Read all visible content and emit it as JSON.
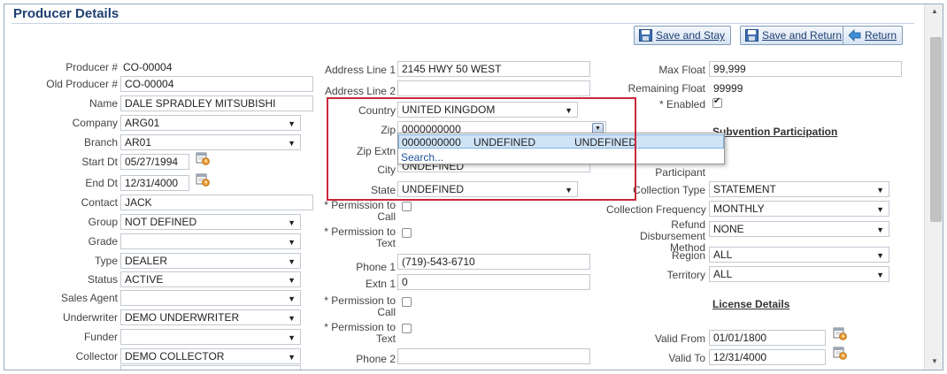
{
  "page_title": "Producer Details",
  "toolbar": {
    "save_stay": "Save and Stay",
    "save_return": "Save and Return",
    "return": "Return"
  },
  "left": {
    "producer_no_label": "Producer #",
    "producer_no": "CO-00004",
    "old_producer_label": "Old Producer #",
    "old_producer": "CO-00004",
    "name_label": "Name",
    "name": "DALE SPRADLEY MITSUBISHI",
    "company_label": "Company",
    "company": "ARG01",
    "branch_label": "Branch",
    "branch": "AR01",
    "start_dt_label": "Start Dt",
    "start_dt": "05/27/1994",
    "end_dt_label": "End Dt",
    "end_dt": "12/31/4000",
    "contact_label": "Contact",
    "contact": "JACK",
    "group_label": "Group",
    "group": "NOT DEFINED",
    "grade_label": "Grade",
    "grade": "",
    "type_label": "Type",
    "type": "DEALER",
    "status_label": "Status",
    "status": "ACTIVE",
    "sales_agent_label": "Sales Agent",
    "sales_agent": "",
    "underwriter_label": "Underwriter",
    "underwriter": "DEMO UNDERWRITER",
    "funder_label": "Funder",
    "funder": "",
    "collector_label": "Collector",
    "collector": "DEMO COLLECTOR"
  },
  "middle": {
    "addr1_label": "Address Line 1",
    "addr1": "2145 HWY 50 WEST",
    "addr2_label": "Address Line 2",
    "addr2": "",
    "country_label": "Country",
    "country": "UNITED KINGDOM",
    "zip_label": "Zip",
    "zip": "0000000000",
    "zip_extn_label": "Zip Extn",
    "city_label": "City",
    "city": "UNDEFINED",
    "state_label": "State",
    "state": "UNDEFINED",
    "perm_call_label": "* Permission to Call",
    "perm_text_label": "* Permission to Text",
    "phone1_label": "Phone 1",
    "phone1": "(719)-543-6710",
    "extn1_label": "Extn 1",
    "extn1": "0",
    "perm_call2_label": "* Permission to Call",
    "perm_text2_label": "* Permission to Text",
    "phone2_label": "Phone 2",
    "phone2": ""
  },
  "zip_dropdown": {
    "row_zip": "0000000000",
    "row_city": "UNDEFINED",
    "row_state": "UNDEFINED",
    "search": "Search..."
  },
  "right": {
    "max_float_label": "Max Float",
    "max_float": "99,999",
    "remaining_float_label": "Remaining Float",
    "remaining_float": "99999",
    "enabled_label": "* Enabled",
    "subvention_title": "Subvention Participation",
    "participant_label": "Participant",
    "collection_type_label": "Collection Type",
    "collection_type": "STATEMENT",
    "collection_freq_label": "Collection Frequency",
    "collection_freq": "MONTHLY",
    "refund_label": "Refund Disbursement Method",
    "refund": "NONE",
    "region_label": "Region",
    "region": "ALL",
    "territory_label": "Territory",
    "territory": "ALL",
    "license_title": "License Details",
    "valid_from_label": "Valid From",
    "valid_from": "01/01/1800",
    "valid_to_label": "Valid To",
    "valid_to": "12/31/4000"
  },
  "colors": {
    "title": "#1f3f73",
    "highlight": "#c8283b",
    "dropdown_selected": "#cfe3f7"
  },
  "icons": [
    "save-icon",
    "return-arrow-icon",
    "calendar-icon",
    "chevron-down-icon",
    "checkbox-icon"
  ]
}
